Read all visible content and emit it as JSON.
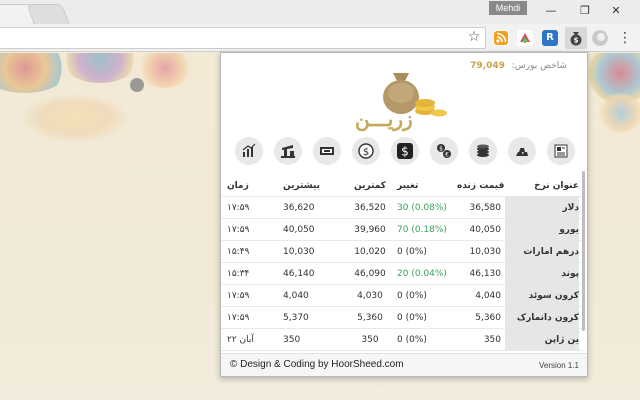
{
  "browser": {
    "user_name": "Mehdi",
    "window_controls": {
      "minimize": "—",
      "maximize": "❐",
      "close": "✕"
    },
    "toolbar_icons": [
      "star-icon",
      "rss-extension-icon",
      "rainbow-extension-icon",
      "blue-extension-icon",
      "moneybag-extension-icon",
      "gray-extension-icon",
      "menu-icon"
    ]
  },
  "popup": {
    "index_label": "شاخص بورس:",
    "index_value": "79,049",
    "logo_text": "زریـــن",
    "categories": [
      {
        "name": "news-icon"
      },
      {
        "name": "gold-bars-icon"
      },
      {
        "name": "coins-icon"
      },
      {
        "name": "exchange-icon"
      },
      {
        "name": "dollar-dark-icon"
      },
      {
        "name": "dollar-circle-icon"
      },
      {
        "name": "banknote-icon"
      },
      {
        "name": "oil-pump-icon"
      },
      {
        "name": "chart-icon"
      }
    ],
    "table": {
      "headers": {
        "name": "عنوان نرخ",
        "price": "قیمت زنده",
        "change": "تغییر",
        "low": "کمترین",
        "high": "بیشترین",
        "time": "زمان"
      },
      "rows": [
        {
          "name": "دلار",
          "price": "36,580",
          "change": "30 (0.08%)",
          "low": "36,520",
          "high": "36,620",
          "time": "۱۷:۵۹",
          "positive": true
        },
        {
          "name": "یورو",
          "price": "40,050",
          "change": "70 (0.18%)",
          "low": "39,960",
          "high": "40,050",
          "time": "۱۷:۵۹",
          "positive": true
        },
        {
          "name": "درهم امارات",
          "price": "10,030",
          "change": "0 (0%)",
          "low": "10,020",
          "high": "10,030",
          "time": "۱۵:۴۹",
          "positive": false
        },
        {
          "name": "پوند",
          "price": "46,130",
          "change": "20 (0.04%)",
          "low": "46,090",
          "high": "46,140",
          "time": "۱۵:۳۴",
          "positive": true
        },
        {
          "name": "کرون سوئد",
          "price": "4,040",
          "change": "0 (0%)",
          "low": "4,030",
          "high": "4,040",
          "time": "۱۷:۵۹",
          "positive": false
        },
        {
          "name": "کرون دانمارک",
          "price": "5,360",
          "change": "0 (0%)",
          "low": "5,360",
          "high": "5,370",
          "time": "۱۷:۵۹",
          "positive": false
        },
        {
          "name": "ین ژاپن",
          "price": "350",
          "change": "0 (0%)",
          "low": "350",
          "high": "350",
          "time": "۲۲ آبان",
          "positive": false
        }
      ]
    },
    "footer": {
      "credit": "© Design & Coding by HoorSheed.com",
      "version": "Version 1.1"
    }
  },
  "colors": {
    "positive_change": "#3aa35a",
    "index_value": "#c9a24a",
    "logo": "#c4a85b"
  }
}
